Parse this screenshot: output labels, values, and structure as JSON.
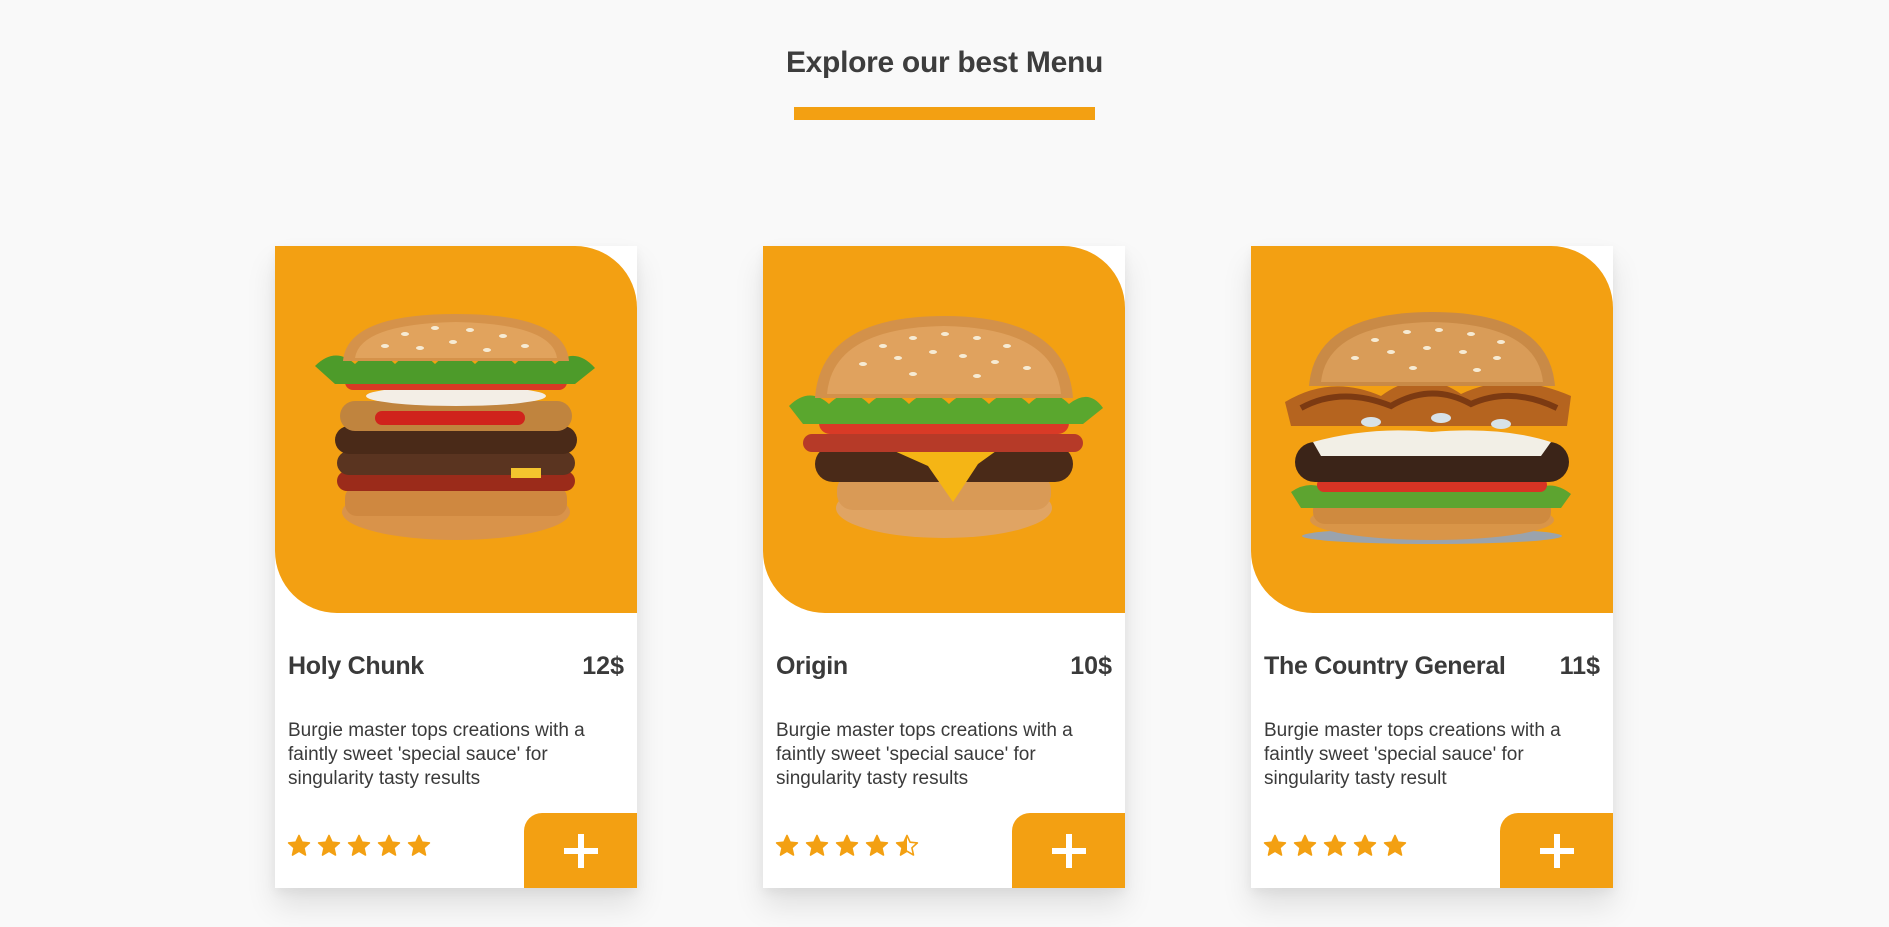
{
  "section": {
    "title": "Explore our best Menu"
  },
  "theme": {
    "accent": "#f3a012",
    "card_bg": "#ffffff",
    "page_bg": "#f9f9f9",
    "text": "#3a3a3a"
  },
  "menu": {
    "items": [
      {
        "name": "Holy Chunk",
        "price": "12$",
        "description": "Burgie master tops creations with a faintly sweet 'special sauce' for singularity tasty results",
        "rating": 5,
        "image_icon": "burger-photo",
        "add_icon": "plus-icon"
      },
      {
        "name": "Origin",
        "price": "10$",
        "description": "Burgie master tops creations with a faintly sweet 'special sauce' for singularity tasty results",
        "rating": 4.5,
        "image_icon": "burger-photo",
        "add_icon": "plus-icon"
      },
      {
        "name": "The Country General",
        "price": "11$",
        "description": "Burgie master tops creations with a faintly sweet 'special sauce' for singularity tasty result",
        "rating": 5,
        "image_icon": "burger-photo",
        "add_icon": "plus-icon"
      }
    ]
  }
}
